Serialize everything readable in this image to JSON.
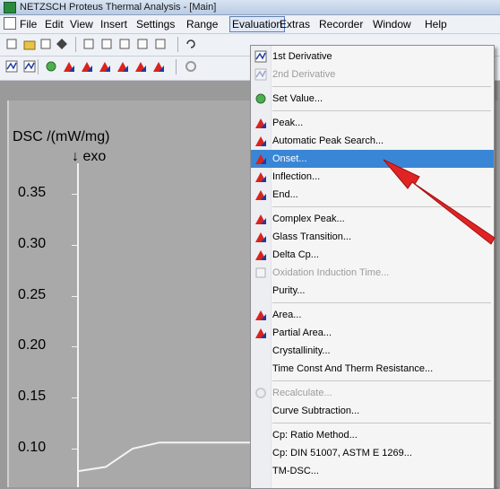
{
  "window": {
    "title": "NETZSCH Proteus Thermal Analysis - [Main]"
  },
  "menubar": {
    "items": [
      "File",
      "Edit",
      "View",
      "Insert",
      "Settings",
      "Range",
      "Evaluation",
      "Extras",
      "Recorder",
      "Window",
      "Help"
    ],
    "active": "Evaluation"
  },
  "toolbar1": {
    "icons": [
      "new-file-icon",
      "open-folder-icon",
      "settings-icon",
      "diamond-icon",
      "copy-icon",
      "preview-icon",
      "print-icon",
      "print-setup-icon",
      "export-icon",
      "undo-icon"
    ]
  },
  "toolbar2": {
    "icons": [
      "derivative-icon",
      "derivative2-icon",
      "set-value-icon",
      "onset-icon",
      "peak-icon",
      "end-icon",
      "area-icon",
      "partial-area-icon",
      "glass-icon",
      "recalc-icon"
    ]
  },
  "chart_data": {
    "type": "line",
    "ylabel": "DSC /(mW/mg)",
    "ylabel2": "↓ exo",
    "yticks": [
      "0.35",
      "0.30",
      "0.25",
      "0.20",
      "0.15",
      "0.10"
    ],
    "ylim": [
      0.08,
      0.37
    ],
    "series": [
      {
        "points": [
          [
            0.0,
            0.078
          ],
          [
            0.03,
            0.082
          ],
          [
            0.06,
            0.1
          ],
          [
            0.09,
            0.106
          ],
          [
            0.14,
            0.106
          ],
          [
            0.2,
            0.106
          ]
        ]
      }
    ]
  },
  "menu": {
    "items": [
      {
        "label": "1st Derivative",
        "icon": "first-derivative-icon",
        "disabled": false
      },
      {
        "label": "2nd Derivative",
        "icon": "second-derivative-icon",
        "disabled": true
      },
      {
        "sep": true
      },
      {
        "label": "Set Value...",
        "icon": "set-value-icon",
        "disabled": false
      },
      {
        "sep": true
      },
      {
        "label": "Peak...",
        "icon": "peak-icon",
        "disabled": false
      },
      {
        "label": "Automatic Peak Search...",
        "icon": "automatic-peak-search-icon",
        "disabled": false
      },
      {
        "label": "Onset...",
        "icon": "onset-icon",
        "disabled": false,
        "highlight": true
      },
      {
        "label": "Inflection...",
        "icon": "inflection-icon",
        "disabled": false
      },
      {
        "label": "End...",
        "icon": "end-icon",
        "disabled": false
      },
      {
        "sep": true
      },
      {
        "label": "Complex Peak...",
        "icon": "complex-peak-icon",
        "disabled": false
      },
      {
        "label": "Glass Transition...",
        "icon": "glass-transition-icon",
        "disabled": false
      },
      {
        "label": "Delta Cp...",
        "icon": "delta-cp-icon",
        "disabled": false
      },
      {
        "label": "Oxidation Induction Time...",
        "icon": "oxidation-induction-time-icon",
        "disabled": true
      },
      {
        "label": "Purity...",
        "icon": "",
        "disabled": false
      },
      {
        "sep": true
      },
      {
        "label": "Area...",
        "icon": "area-icon",
        "disabled": false
      },
      {
        "label": "Partial Area...",
        "icon": "partial-area-icon",
        "disabled": false
      },
      {
        "label": "Crystallinity...",
        "icon": "",
        "disabled": false
      },
      {
        "label": "Time Const And Therm Resistance...",
        "icon": "",
        "disabled": false
      },
      {
        "sep": true
      },
      {
        "label": "Recalculate...",
        "icon": "recalculate-icon",
        "disabled": true
      },
      {
        "label": "Curve Subtraction...",
        "icon": "",
        "disabled": false
      },
      {
        "sep": true
      },
      {
        "label": "Cp: Ratio Method...",
        "icon": "",
        "disabled": false
      },
      {
        "label": "Cp: DIN 51007, ASTM E 1269...",
        "icon": "",
        "disabled": false
      },
      {
        "label": "TM-DSC...",
        "icon": "",
        "disabled": false
      }
    ]
  },
  "colors": {
    "highlight": "#3a86d6",
    "annotation_arrow": "#e02424",
    "peak_red": "#d9231e",
    "peak_blue": "#1f3b9c"
  }
}
